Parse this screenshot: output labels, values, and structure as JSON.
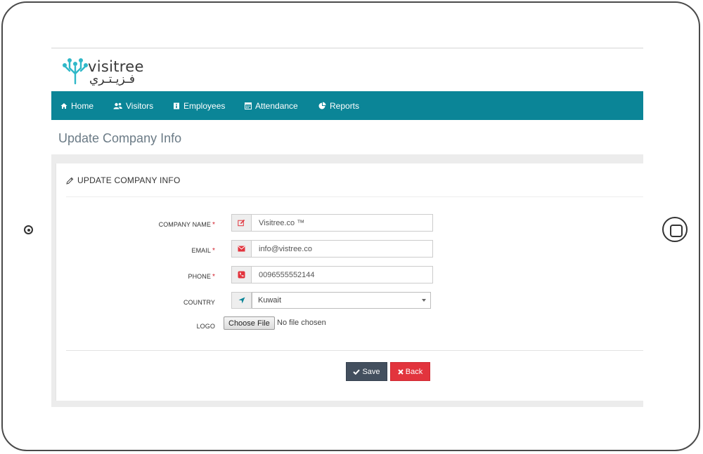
{
  "brand": {
    "name": "visitree",
    "arabic": "فـزيـتـري"
  },
  "nav": {
    "items": [
      {
        "label": "Home",
        "icon": "home-icon"
      },
      {
        "label": "Visitors",
        "icon": "users-icon"
      },
      {
        "label": "Employees",
        "icon": "id-card-icon"
      },
      {
        "label": "Attendance",
        "icon": "calendar-icon"
      },
      {
        "label": "Reports",
        "icon": "pie-chart-icon"
      }
    ],
    "color": "#0b8597"
  },
  "page": {
    "title": "Update Company Info"
  },
  "panel": {
    "title": "UPDATE COMPANY INFO",
    "icon": "pencil-icon"
  },
  "form": {
    "company_name": {
      "label": "COMPANY NAME",
      "value": "Visitree.co ™",
      "required": "*",
      "icon": "edit-icon"
    },
    "email": {
      "label": "EMAIL",
      "value": "info@vistree.co",
      "required": "*",
      "icon": "envelope-icon"
    },
    "phone": {
      "label": "PHONE",
      "value": "0096555552144",
      "required": "*",
      "icon": "phone-icon"
    },
    "country": {
      "label": "COUNTRY",
      "value": "Kuwait",
      "icon": "location-arrow-icon"
    },
    "logo": {
      "label": "LOGO",
      "button": "Choose File",
      "status": "No file chosen"
    }
  },
  "actions": {
    "save": "Save",
    "back": "Back",
    "save_color": "#434f5e",
    "back_color": "#e2343d"
  }
}
